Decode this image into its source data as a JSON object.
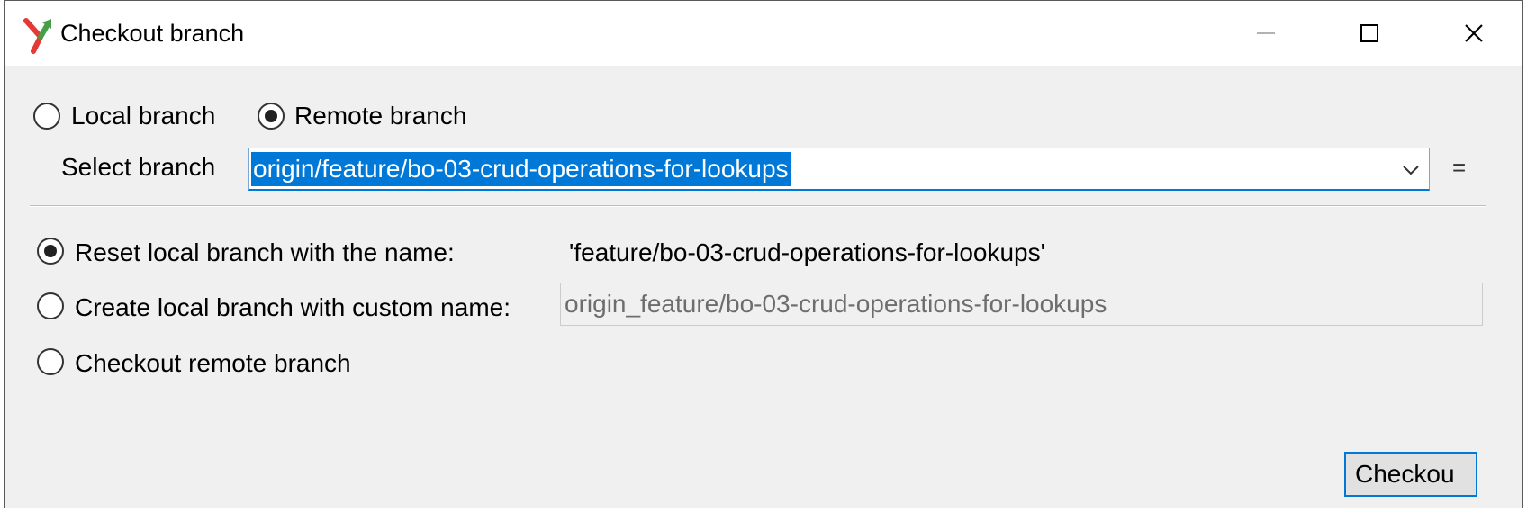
{
  "window": {
    "title": "Checkout branch"
  },
  "branch_type": {
    "local_label": "Local branch",
    "remote_label": "Remote branch",
    "selected": "remote"
  },
  "select_branch": {
    "label": "Select branch",
    "value": "origin/feature/bo-03-crud-operations-for-lookups",
    "extra_button": "="
  },
  "options": {
    "reset_label": "Reset local branch with the name:",
    "reset_value": "'feature/bo-03-crud-operations-for-lookups'",
    "custom_label": "Create local branch with custom name:",
    "custom_value": "origin_feature/bo-03-crud-operations-for-lookups",
    "checkout_remote_label": "Checkout remote branch",
    "selected": "reset"
  },
  "buttons": {
    "checkout": "Checkou"
  },
  "colors": {
    "accent": "#0078d7",
    "dialog_bg": "#f0f0f0",
    "icon_red": "#e53935",
    "icon_green": "#43a047"
  },
  "icons": {
    "app": "git-branch-merge-icon",
    "minimize": "minimize-icon",
    "maximize": "maximize-icon",
    "close": "close-icon",
    "dropdown": "chevron-down-icon"
  }
}
